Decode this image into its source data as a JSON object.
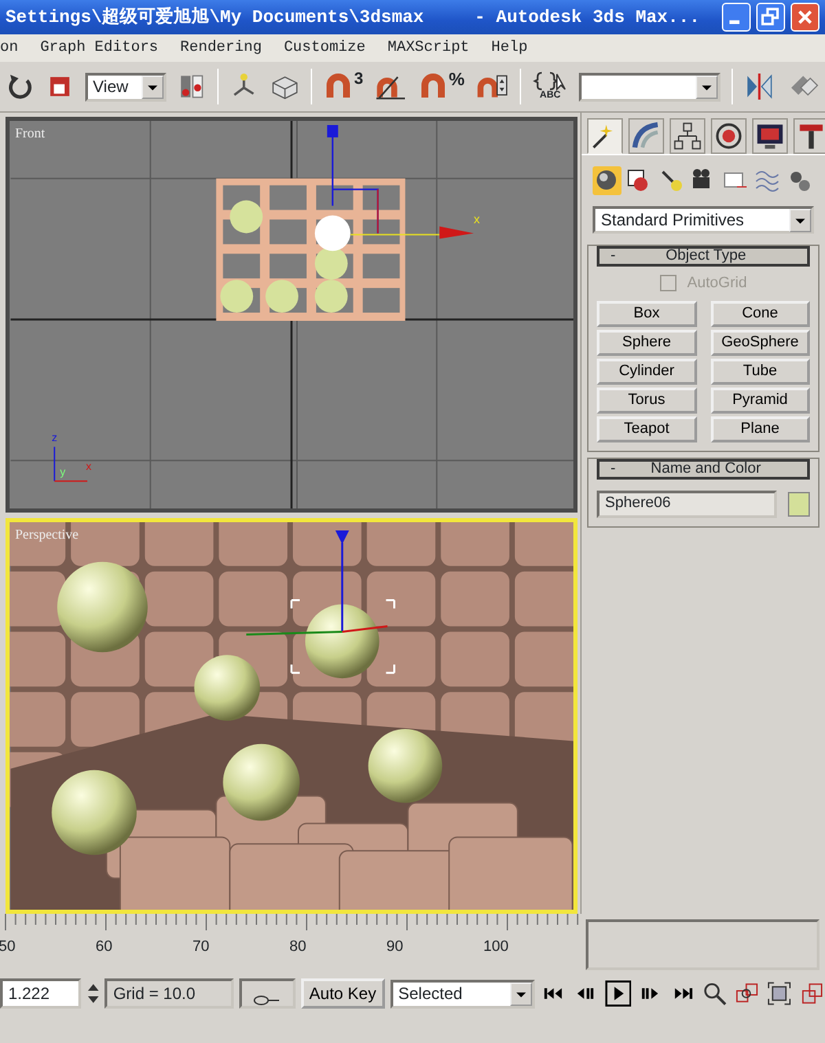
{
  "window": {
    "title_path": "Settings\\超级可爱旭旭\\My Documents\\3dsmax",
    "title_app": "- Autodesk 3ds Max..."
  },
  "menu": [
    "on",
    "Graph Editors",
    "Rendering",
    "Customize",
    "MAXScript",
    "Help"
  ],
  "toolbar": [
    {
      "kind": "redo"
    },
    {
      "kind": "region"
    },
    {
      "kind": "dropdown",
      "value": "View"
    },
    {
      "kind": "pivot"
    },
    {
      "kind": "separator"
    },
    {
      "kind": "transform-gizmo"
    },
    {
      "kind": "manipulate"
    },
    {
      "kind": "separator"
    },
    {
      "kind": "snap",
      "text": "3"
    },
    {
      "kind": "angle-snap"
    },
    {
      "kind": "percent-snap",
      "text": "%"
    },
    {
      "kind": "spinner-snap"
    },
    {
      "kind": "separator"
    },
    {
      "kind": "named-sets",
      "text": "ABC"
    },
    {
      "kind": "dropdown"
    },
    {
      "kind": "separator"
    },
    {
      "kind": "mirror"
    },
    {
      "kind": "align"
    }
  ],
  "viewports": [
    {
      "kind": "front",
      "label": "Front",
      "selected": false,
      "gizmo_label": "x",
      "tripod_labels": [
        "z",
        "y",
        "x"
      ]
    },
    {
      "kind": "perspective",
      "label": "Perspective",
      "selected": true
    }
  ],
  "command_panel": {
    "tabs": [
      {
        "kind": "create",
        "selected": true
      },
      {
        "kind": "modify",
        "selected": false
      },
      {
        "kind": "hierarchy",
        "selected": false
      },
      {
        "kind": "motion",
        "selected": false
      },
      {
        "kind": "display",
        "selected": false
      },
      {
        "kind": "utilities",
        "selected": false
      }
    ],
    "categories": [
      {
        "kind": "geometry",
        "selected": true
      },
      {
        "kind": "shapes",
        "selected": false
      },
      {
        "kind": "lights",
        "selected": false
      },
      {
        "kind": "cameras",
        "selected": false
      },
      {
        "kind": "helpers",
        "selected": false
      },
      {
        "kind": "spacewarps",
        "selected": false
      },
      {
        "kind": "systems",
        "selected": false
      }
    ],
    "dropdown": "Standard Primitives",
    "rollouts": [
      {
        "kind": "object_type",
        "toggle": "-",
        "title": "Object Type",
        "autogrid": {
          "label": "AutoGrid",
          "checked": false,
          "disabled": true
        },
        "buttons": [
          "Box",
          "Cone",
          "Sphere",
          "GeoSphere",
          "Cylinder",
          "Tube",
          "Torus",
          "Pyramid",
          "Teapot",
          "Plane"
        ]
      },
      {
        "kind": "name_color",
        "toggle": "-",
        "title": "Name and Color",
        "name": "Sphere06",
        "color": "#d4e09a"
      }
    ]
  },
  "time_ruler": {
    "labels": [
      "50",
      "60",
      "70",
      "80",
      "90",
      "100"
    ]
  },
  "status_bar": {
    "coordinate": "1.222",
    "grid": "Grid = 10.0",
    "auto_key": "Auto Key",
    "key_filter": "Selected"
  }
}
